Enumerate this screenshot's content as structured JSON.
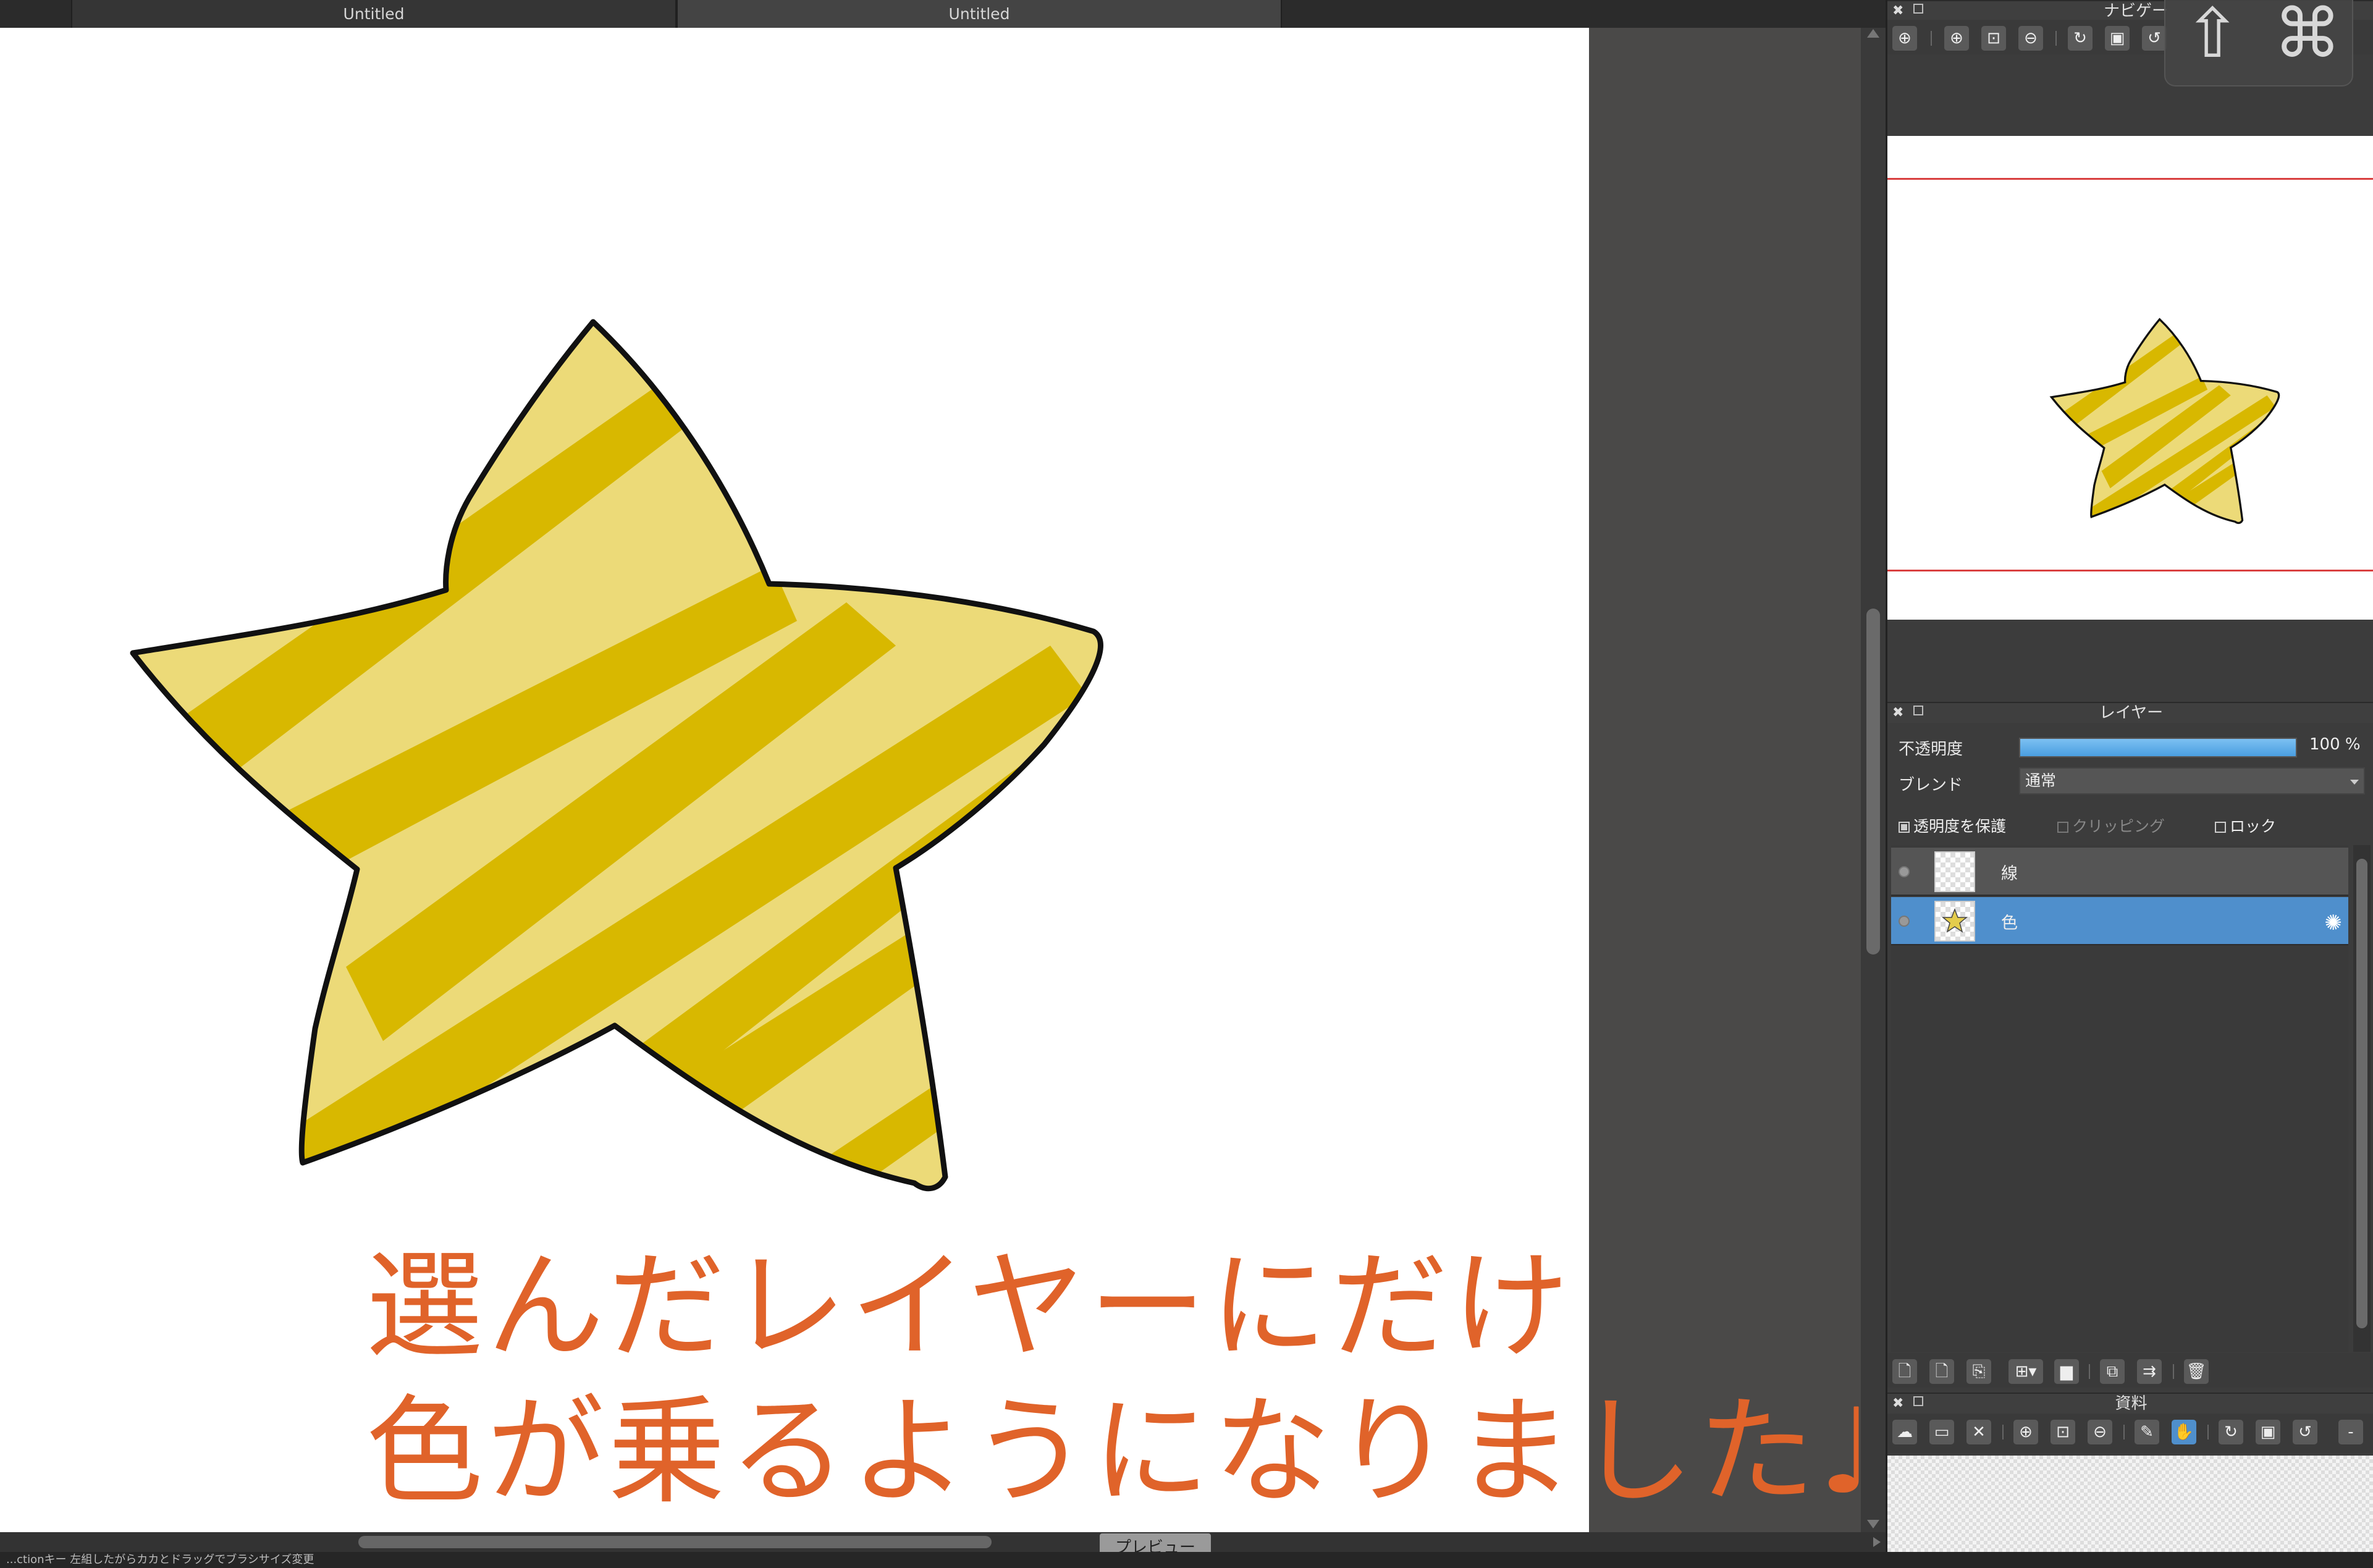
{
  "tabs": [
    {
      "label": "Untitled"
    },
    {
      "label": "Untitled"
    }
  ],
  "canvas": {
    "caption_line1": "選んだレイヤーにだけ",
    "caption_line2": "色が乗るようになりました♩",
    "caption_color": "#e0632a"
  },
  "preview_button": "プレビュー",
  "status_text": "...ctionキー 左組したがらカカとドラッグでブラシサイズ変更",
  "navigator": {
    "title": "ナビゲー",
    "icons": [
      "zoom-in-icon",
      "zoom-in-icon",
      "fit-icon",
      "zoom-out-icon",
      "rotate-icon",
      "fit-screen-icon",
      "rotate-reset-icon"
    ]
  },
  "layers_panel": {
    "title": "レイヤー",
    "opacity_label": "不透明度",
    "opacity_value": "100 %",
    "opacity_fraction": 1.0,
    "blend_label": "ブレンド",
    "blend_value": "通常",
    "protect_alpha_label": "透明度を保護",
    "protect_alpha_checked": true,
    "clipping_label": "クリッピング",
    "lock_label": "ロック",
    "layers": [
      {
        "name": "線",
        "selected": false
      },
      {
        "name": "色",
        "selected": true
      }
    ]
  },
  "materials_panel": {
    "title": "資料"
  },
  "key_overlay": {
    "shift": "⇧",
    "command": "⌘"
  },
  "colors": {
    "accent": "#4f8fcc",
    "star_light": "#ecda78",
    "star_dark": "#d8b800",
    "nav_frame": "#d94040"
  }
}
